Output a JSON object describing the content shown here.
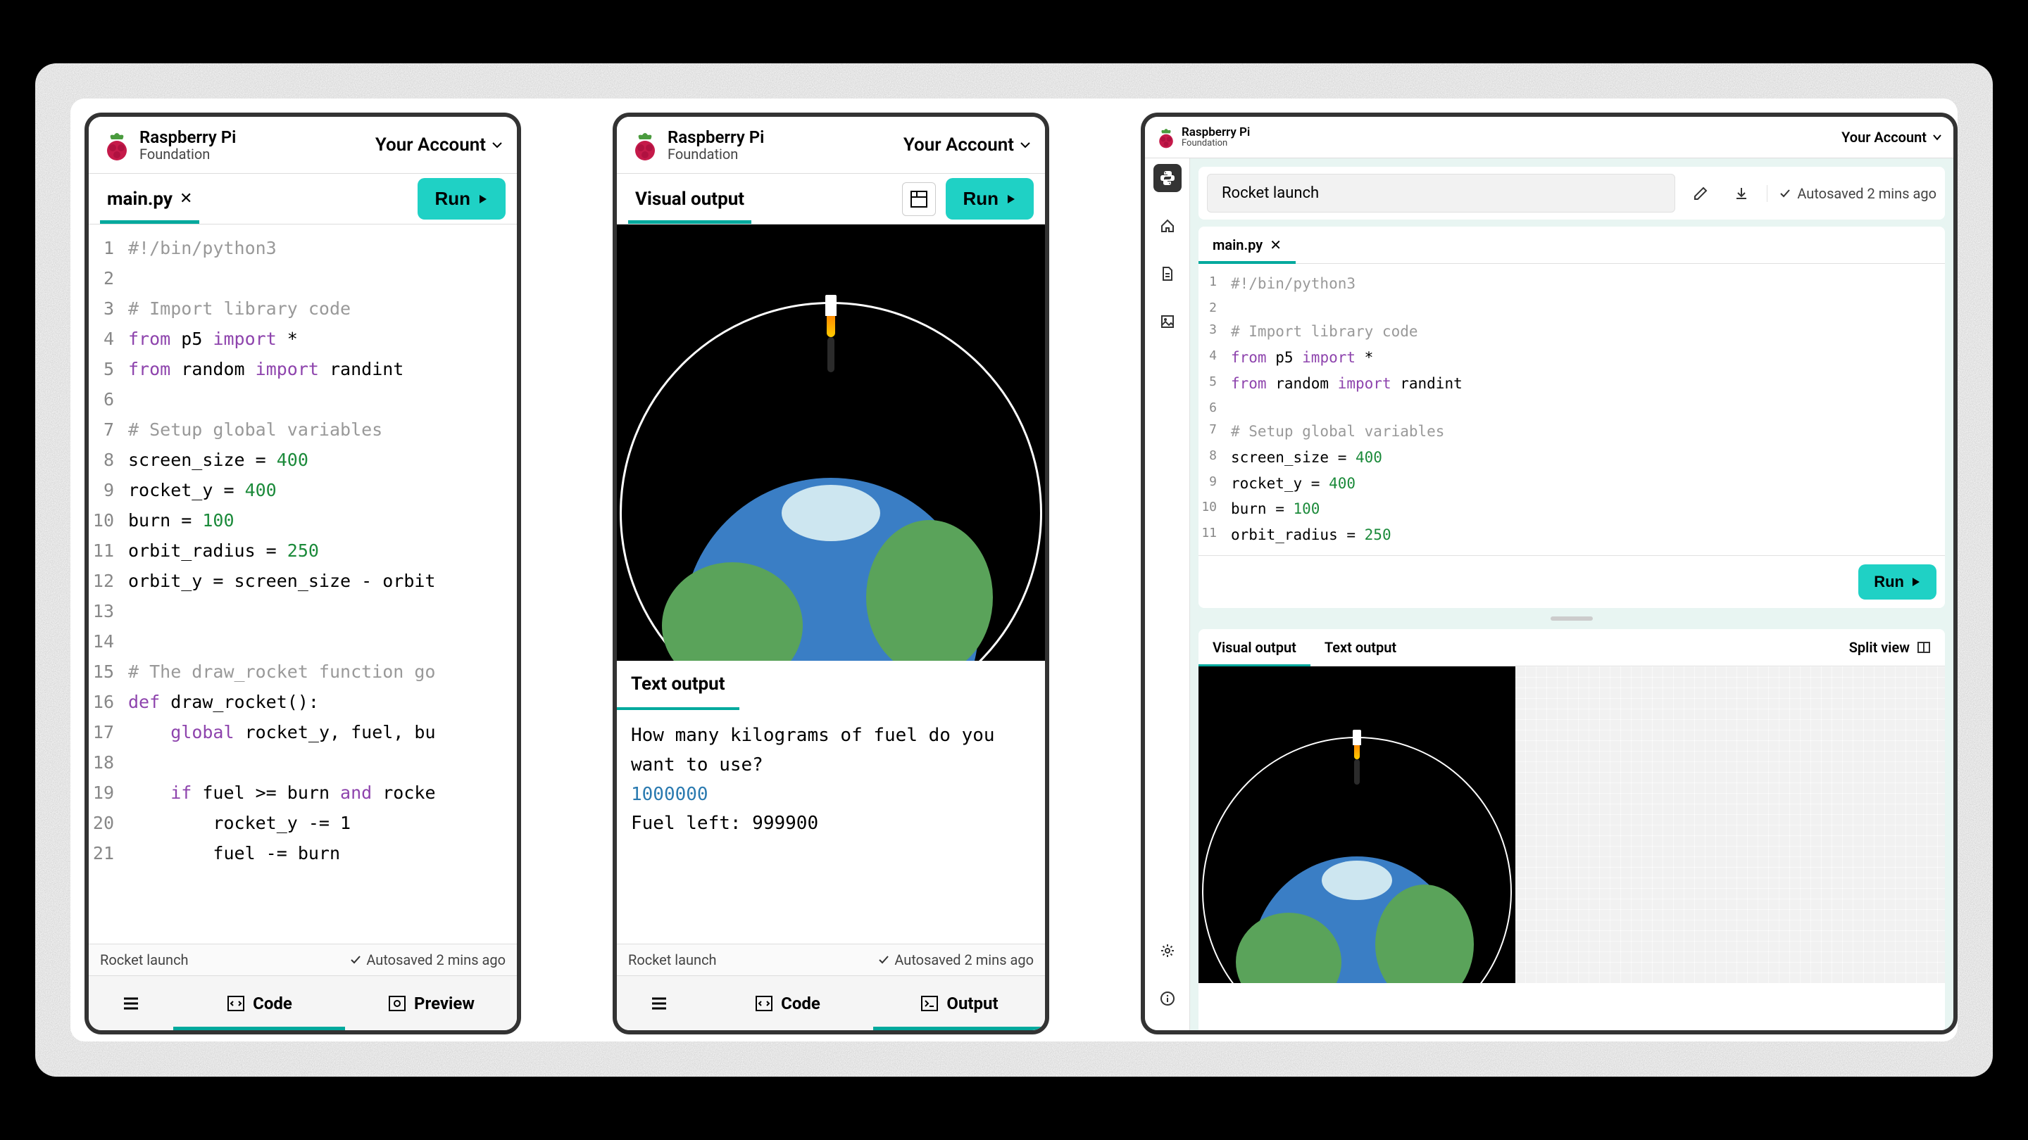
{
  "brand": {
    "title": "Raspberry Pi",
    "subtitle": "Foundation"
  },
  "account_label": "Your Account",
  "run_label": "Run",
  "autosave_label": "Autosaved 2 mins ago",
  "project_name": "Rocket launch",
  "frame1": {
    "tab_file": "main.py",
    "bottom": {
      "code": "Code",
      "preview": "Preview"
    }
  },
  "frame2": {
    "tab_label": "Visual output",
    "text_output_label": "Text output",
    "text_output_lines": [
      "How many kilograms of fuel do you want to use?",
      "1000000",
      "Fuel left: 999900"
    ],
    "bottom": {
      "code": "Code",
      "output": "Output"
    }
  },
  "frame3": {
    "tab_file": "main.py",
    "visual_tab": "Visual output",
    "text_tab": "Text output",
    "split_view": "Split view"
  },
  "code_lines": [
    {
      "n": 1,
      "tokens": [
        [
          "comment",
          "#!/bin/python3"
        ]
      ]
    },
    {
      "n": 2,
      "tokens": []
    },
    {
      "n": 3,
      "tokens": [
        [
          "comment",
          "# Import library code"
        ]
      ]
    },
    {
      "n": 4,
      "tokens": [
        [
          "keyword",
          "from"
        ],
        [
          "plain",
          " p5 "
        ],
        [
          "keyword",
          "import"
        ],
        [
          "plain",
          " *"
        ]
      ]
    },
    {
      "n": 5,
      "tokens": [
        [
          "keyword",
          "from"
        ],
        [
          "plain",
          " random "
        ],
        [
          "keyword",
          "import"
        ],
        [
          "plain",
          " randint"
        ]
      ]
    },
    {
      "n": 6,
      "tokens": []
    },
    {
      "n": 7,
      "tokens": [
        [
          "comment",
          "# Setup global variables"
        ]
      ]
    },
    {
      "n": 8,
      "tokens": [
        [
          "plain",
          "screen_size = "
        ],
        [
          "number",
          "400"
        ]
      ]
    },
    {
      "n": 9,
      "tokens": [
        [
          "plain",
          "rocket_y = "
        ],
        [
          "number",
          "400"
        ]
      ]
    },
    {
      "n": 10,
      "tokens": [
        [
          "plain",
          "burn = "
        ],
        [
          "number",
          "100"
        ]
      ]
    },
    {
      "n": 11,
      "tokens": [
        [
          "plain",
          "orbit_radius = "
        ],
        [
          "number",
          "250"
        ]
      ]
    },
    {
      "n": 12,
      "tokens": [
        [
          "plain",
          "orbit_y = screen_size - orbit"
        ]
      ]
    },
    {
      "n": 13,
      "tokens": []
    },
    {
      "n": 14,
      "tokens": []
    },
    {
      "n": 15,
      "tokens": [
        [
          "comment",
          "# The draw_rocket function go"
        ]
      ]
    },
    {
      "n": 16,
      "tokens": [
        [
          "keyword",
          "def"
        ],
        [
          "plain",
          " draw_rocket():"
        ]
      ]
    },
    {
      "n": 17,
      "tokens": [
        [
          "plain",
          "    "
        ],
        [
          "keyword",
          "global"
        ],
        [
          "plain",
          " rocket_y, fuel, bu"
        ]
      ]
    },
    {
      "n": 18,
      "tokens": []
    },
    {
      "n": 19,
      "tokens": [
        [
          "plain",
          "    "
        ],
        [
          "keyword",
          "if"
        ],
        [
          "plain",
          " fuel >= burn "
        ],
        [
          "keyword",
          "and"
        ],
        [
          "plain",
          " rocke"
        ]
      ]
    },
    {
      "n": 20,
      "tokens": [
        [
          "plain",
          "        rocket_y -= 1"
        ]
      ]
    },
    {
      "n": 21,
      "tokens": [
        [
          "plain",
          "        fuel -= burn"
        ]
      ]
    }
  ],
  "code_lines_tablet_count": 11
}
